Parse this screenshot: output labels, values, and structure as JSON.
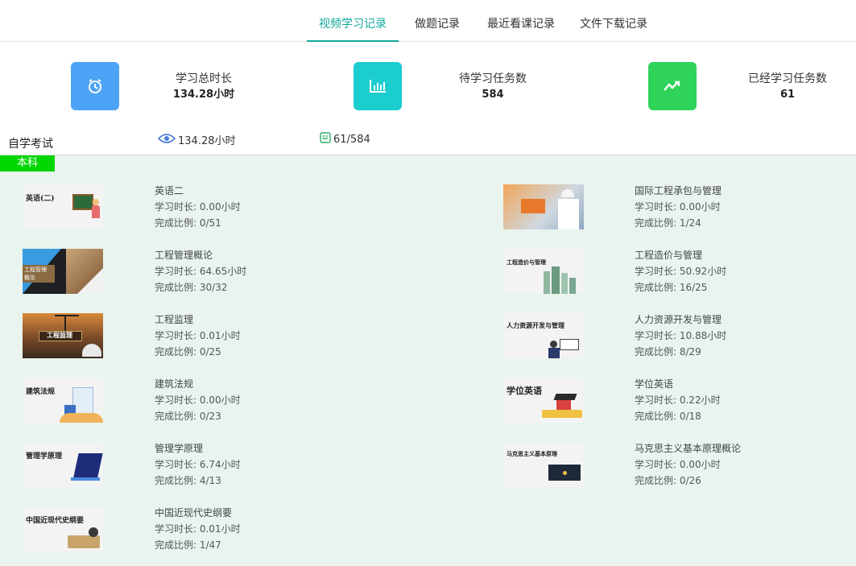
{
  "tabs": [
    {
      "label": "视频学习记录",
      "active": true
    },
    {
      "label": "做题记录",
      "active": false
    },
    {
      "label": "最近看课记录",
      "active": false
    },
    {
      "label": "文件下载记录",
      "active": false
    }
  ],
  "stats": [
    {
      "label": "学习总时长",
      "value": "134.28小时",
      "color": "#4da3f5",
      "icon": "clock-icon"
    },
    {
      "label": "待学习任务数",
      "value": "584",
      "color": "#1ccdd0",
      "icon": "bar-chart-icon"
    },
    {
      "label": "已经学习任务数",
      "value": "61",
      "color": "#2fd35a",
      "icon": "trend-icon"
    }
  ],
  "subject": {
    "name": "自学考试",
    "duration": "134.28小时",
    "progress": "61/584"
  },
  "level": "本科",
  "courses": [
    {
      "name": "英语二",
      "duration": "学习时长: 0.00小时",
      "ratio": "完成比例: 0/51",
      "thumb_title": "英语(二)"
    },
    {
      "name": "国际工程承包与管理",
      "duration": "学习时长: 0.00小时",
      "ratio": "完成比例: 1/24",
      "thumb_title": ""
    },
    {
      "name": "工程管理概论",
      "duration": "学习时长: 64.65小时",
      "ratio": "完成比例: 30/32",
      "thumb_title": ""
    },
    {
      "name": "工程造价与管理",
      "duration": "学习时长: 50.92小时",
      "ratio": "完成比例: 16/25",
      "thumb_title": "工程造价与管理"
    },
    {
      "name": "工程监理",
      "duration": "学习时长: 0.01小时",
      "ratio": "完成比例: 0/25",
      "thumb_title": "工程监理"
    },
    {
      "name": "人力资源开发与管理",
      "duration": "学习时长: 10.88小时",
      "ratio": "完成比例: 8/29",
      "thumb_title": "人力资源开发与管理"
    },
    {
      "name": "建筑法规",
      "duration": "学习时长: 0.00小时",
      "ratio": "完成比例: 0/23",
      "thumb_title": "建筑法规"
    },
    {
      "name": "学位英语",
      "duration": "学习时长: 0.22小时",
      "ratio": "完成比例: 0/18",
      "thumb_title": "学位英语"
    },
    {
      "name": "管理学原理",
      "duration": "学习时长: 6.74小时",
      "ratio": "完成比例: 4/13",
      "thumb_title": "管理学原理"
    },
    {
      "name": "马克思主义基本原理概论",
      "duration": "学习时长: 0.00小时",
      "ratio": "完成比例: 0/26",
      "thumb_title": "马克思主义基本原理"
    },
    {
      "name": "中国近现代史纲要",
      "duration": "学习时长: 0.01小时",
      "ratio": "完成比例: 1/47",
      "thumb_title": "中国近现代史纲要"
    }
  ]
}
